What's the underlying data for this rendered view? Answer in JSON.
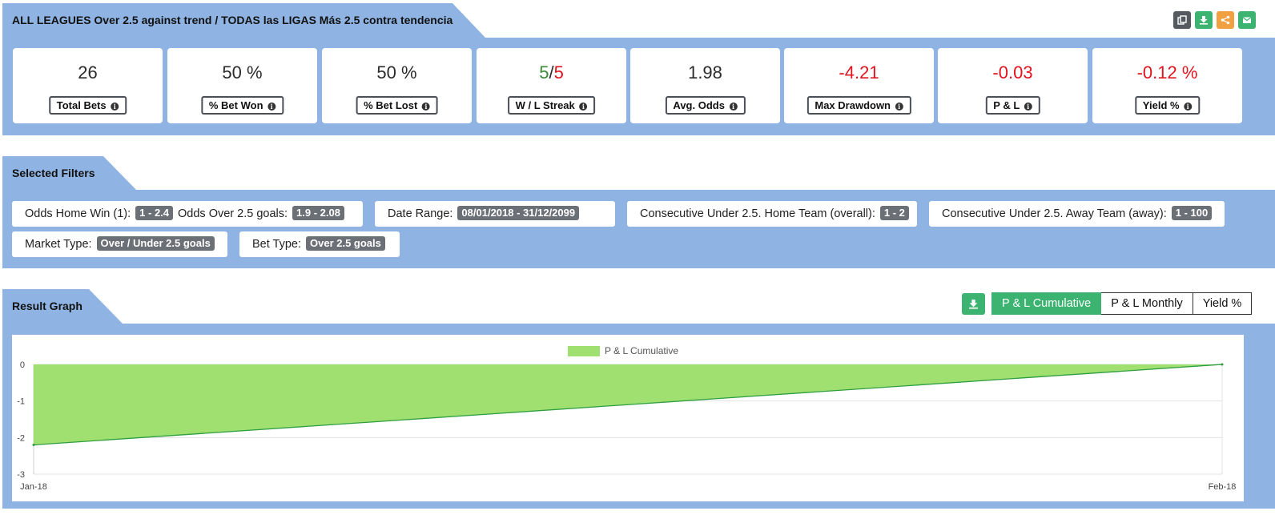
{
  "header": {
    "title": "ALL LEAGUES Over 2.5 against trend / TODAS las LIGAS Más 2.5 contra tendencia",
    "actions": [
      {
        "name": "copy-icon",
        "color": "#555a60"
      },
      {
        "name": "download-icon",
        "color": "#3cb371"
      },
      {
        "name": "share-icon",
        "color": "#f0a040"
      },
      {
        "name": "email-icon",
        "color": "#3cb371"
      }
    ]
  },
  "stats": {
    "total_bets": {
      "value": "26",
      "label": "Total Bets"
    },
    "bet_won": {
      "value": "50 %",
      "label": "% Bet Won"
    },
    "bet_lost": {
      "value": "50 %",
      "label": "% Bet Lost"
    },
    "streak": {
      "win": "5",
      "sep": "/",
      "loss": "5",
      "label": "W / L Streak"
    },
    "avg_odds": {
      "value": "1.98",
      "label": "Avg. Odds"
    },
    "max_drawdown": {
      "value": "-4.21",
      "label": "Max Drawdown"
    },
    "pl": {
      "value": "-0.03",
      "label": "P & L"
    },
    "yield": {
      "value": "-0.12 %",
      "label": "Yield %"
    }
  },
  "filters": {
    "title": "Selected Filters",
    "items": [
      {
        "label": "Odds Home Win (1):",
        "value": "1 - 2.4",
        "label2": "Odds Over 2.5 goals:",
        "value2": "1.9 - 2.08"
      },
      {
        "label": "Date Range:",
        "value": "08/01/2018 - 31/12/2099"
      },
      {
        "label": "Consecutive Under 2.5. Home Team (overall):",
        "value": "1 - 2"
      },
      {
        "label": "Consecutive Under 2.5. Away Team (away):",
        "value": "1 - 100"
      },
      {
        "label": "Market Type:",
        "value": "Over / Under 2.5 goals"
      },
      {
        "label": "Bet Type:",
        "value": "Over 2.5 goals"
      }
    ]
  },
  "graph": {
    "title": "Result Graph",
    "tabs": [
      "P & L Cumulative",
      "P & L Monthly",
      "Yield %"
    ],
    "active_tab": "P & L Cumulative"
  },
  "chart_data": {
    "type": "area",
    "legend": [
      "P & L Cumulative"
    ],
    "legend_position": "top",
    "x": [
      "Jan-18",
      "Feb-18"
    ],
    "series": [
      {
        "name": "P & L Cumulative",
        "values": [
          -2.2,
          0
        ]
      }
    ],
    "ylim": [
      -3,
      0
    ],
    "yticks": [
      "0",
      "-1",
      "-2",
      "-3"
    ],
    "grid": true,
    "fill_color": "#9fe070",
    "line_color": "#2f9e3f"
  }
}
